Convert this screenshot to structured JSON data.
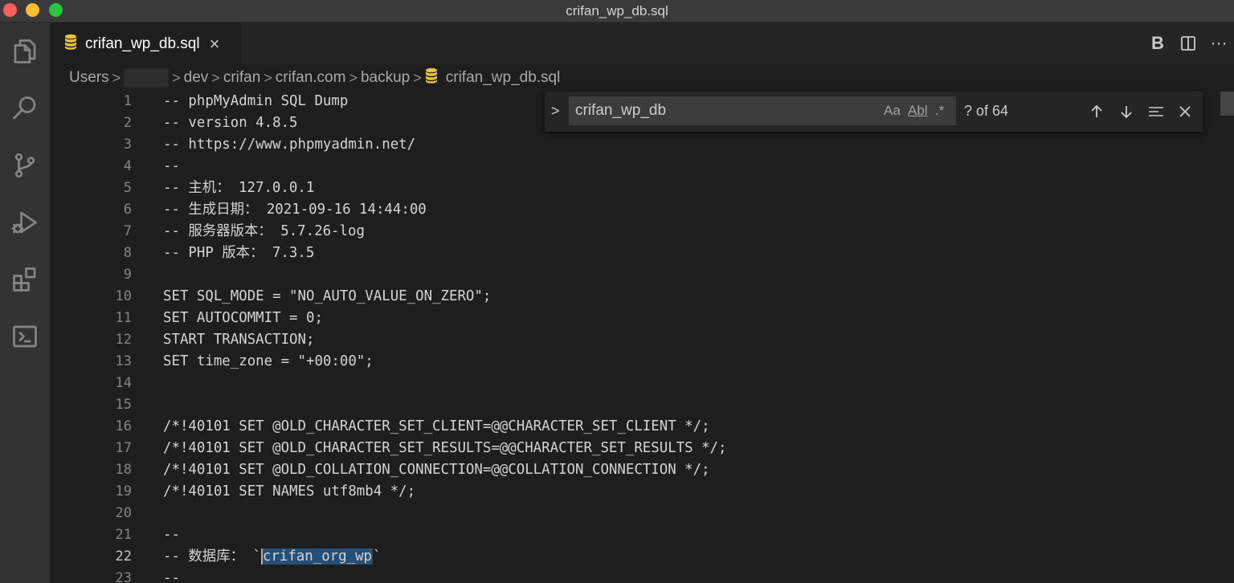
{
  "window": {
    "title": "crifan_wp_db.sql"
  },
  "tab": {
    "label": "crifan_wp_db.sql",
    "close_glyph": "×"
  },
  "tab_actions": [
    {
      "name": "markdown-bold-button",
      "glyph": "B"
    },
    {
      "name": "split-editor-button",
      "glyph": "split-icon"
    },
    {
      "name": "more-actions-button",
      "glyph": "···"
    }
  ],
  "breadcrumb": {
    "items": [
      "Users",
      "dev",
      "crifan",
      "crifan.com",
      "backup"
    ],
    "file": "crifan_wp_db.sql",
    "separator": ">"
  },
  "find": {
    "toggle_glyph": ">",
    "value": "crifan_wp_db",
    "match_case": "Aa",
    "whole_word": "Abl",
    "regex": ".*",
    "count": "? of 64"
  },
  "editor": {
    "active_line": 22,
    "lines": [
      {
        "n": "1",
        "text": "-- phpMyAdmin SQL Dump"
      },
      {
        "n": "2",
        "text": "-- version 4.8.5"
      },
      {
        "n": "3",
        "text": "-- https://www.phpmyadmin.net/"
      },
      {
        "n": "4",
        "text": "--"
      },
      {
        "n": "5",
        "text": "-- 主机： 127.0.0.1"
      },
      {
        "n": "6",
        "text": "-- 生成日期： 2021-09-16 14:44:00"
      },
      {
        "n": "7",
        "text": "-- 服务器版本： 5.7.26-log"
      },
      {
        "n": "8",
        "text": "-- PHP 版本： 7.3.5"
      },
      {
        "n": "9",
        "text": ""
      },
      {
        "n": "10",
        "text": "SET SQL_MODE = \"NO_AUTO_VALUE_ON_ZERO\";"
      },
      {
        "n": "11",
        "text": "SET AUTOCOMMIT = 0;"
      },
      {
        "n": "12",
        "text": "START TRANSACTION;"
      },
      {
        "n": "13",
        "text": "SET time_zone = \"+00:00\";"
      },
      {
        "n": "14",
        "text": ""
      },
      {
        "n": "15",
        "text": ""
      },
      {
        "n": "16",
        "text": "/*!40101 SET @OLD_CHARACTER_SET_CLIENT=@@CHARACTER_SET_CLIENT */;"
      },
      {
        "n": "17",
        "text": "/*!40101 SET @OLD_CHARACTER_SET_RESULTS=@@CHARACTER_SET_RESULTS */;"
      },
      {
        "n": "18",
        "text": "/*!40101 SET @OLD_COLLATION_CONNECTION=@@COLLATION_CONNECTION */;"
      },
      {
        "n": "19",
        "text": "/*!40101 SET NAMES utf8mb4 */;"
      },
      {
        "n": "20",
        "text": ""
      },
      {
        "n": "21",
        "text": "--"
      },
      {
        "n": "22",
        "text": "-- 数据库： `",
        "highlight": "crifan_org_wp",
        "after": "`"
      },
      {
        "n": "23",
        "text": "--"
      }
    ]
  },
  "colors": {
    "editor_bg": "#1e1e1e",
    "activity_bar": "#333333",
    "selection": "#264f78",
    "db_icon": "#e8c33c"
  }
}
